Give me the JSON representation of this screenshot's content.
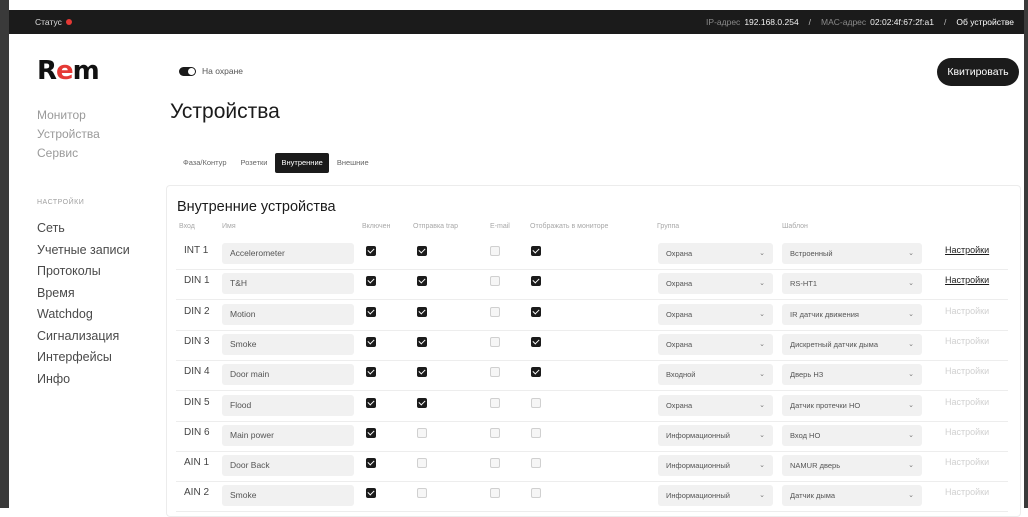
{
  "topbar": {
    "status_label": "Статус",
    "ip_label": "IP-адрес",
    "ip_value": "192.168.0.254",
    "mac_label": "MAC-адрес",
    "mac_value": "02:02:4f:67:2f:a1",
    "separator": "/",
    "about": "Об устройстве",
    "status_color": "#e53935"
  },
  "logo": {
    "r": "R",
    "e": "e",
    "m": "m"
  },
  "nav": [
    "Монитор",
    "Устройства",
    "Сервис"
  ],
  "settings_section": "НАСТРОЙКИ",
  "nav_settings": [
    "Сеть",
    "Учетные записи",
    "Протоколы",
    "Время",
    "Watchdog",
    "Сигнализация",
    "Интерфейсы",
    "Инфо"
  ],
  "guard": {
    "label": "На охране"
  },
  "ack_button": "Квитировать",
  "page_title": "Устройства",
  "tabs": [
    "Фаза/Контур",
    "Розетки",
    "Внутренние",
    "Внешние"
  ],
  "section_title": "Внутренние устройства",
  "columns": {
    "input": "Вход",
    "name": "Имя",
    "enabled": "Включен",
    "trap": "Отправка trap",
    "email": "E-mail",
    "monitor": "Отображать в мониторе",
    "group": "Группа",
    "template": "Шаблон"
  },
  "settings_link": "Настройки",
  "rows": [
    {
      "id": "INT 1",
      "name": "Accelerometer",
      "enabled": true,
      "trap": true,
      "email": false,
      "monitor": true,
      "group": "Охрана",
      "template": "Встроенный",
      "settings_active": true
    },
    {
      "id": "DIN 1",
      "name": "T&H",
      "enabled": true,
      "trap": true,
      "email": false,
      "monitor": true,
      "group": "Охрана",
      "template": "RS-HT1",
      "settings_active": true
    },
    {
      "id": "DIN 2",
      "name": "Motion",
      "enabled": true,
      "trap": true,
      "email": false,
      "monitor": true,
      "group": "Охрана",
      "template": "IR датчик движения",
      "settings_active": false
    },
    {
      "id": "DIN 3",
      "name": "Smoke",
      "enabled": true,
      "trap": true,
      "email": false,
      "monitor": true,
      "group": "Охрана",
      "template": "Дискретный датчик дыма",
      "settings_active": false
    },
    {
      "id": "DIN 4",
      "name": "Door main",
      "enabled": true,
      "trap": true,
      "email": false,
      "monitor": true,
      "group": "Входной",
      "template": "Дверь НЗ",
      "settings_active": false
    },
    {
      "id": "DIN 5",
      "name": "Flood",
      "enabled": true,
      "trap": true,
      "email": false,
      "monitor": false,
      "group": "Охрана",
      "template": "Датчик протечки НО",
      "settings_active": false
    },
    {
      "id": "DIN 6",
      "name": "Main power",
      "enabled": true,
      "trap": false,
      "email": false,
      "monitor": false,
      "group": "Информационный",
      "template": "Вход НО",
      "settings_active": false
    },
    {
      "id": "AIN 1",
      "name": "Door Back",
      "enabled": true,
      "trap": false,
      "email": false,
      "monitor": false,
      "group": "Информационный",
      "template": "NAMUR дверь",
      "settings_active": false
    },
    {
      "id": "AIN 2",
      "name": "Smoke",
      "enabled": true,
      "trap": false,
      "email": false,
      "monitor": false,
      "group": "Информационный",
      "template": "Датчик дыма",
      "settings_active": false
    }
  ]
}
